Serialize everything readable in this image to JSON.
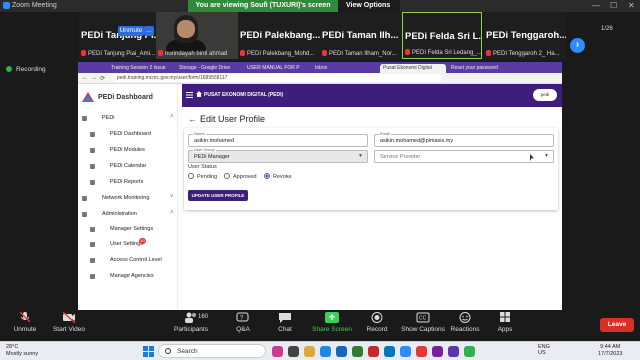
{
  "zoom_window": {
    "title": "Zoom Meeting",
    "viewing_banner": "You are viewing Soufi (TUXURI)'s screen",
    "view_options": "View Options",
    "window_controls": {
      "minimize": "—",
      "maximize": "☐",
      "close": "✕"
    }
  },
  "gallery": {
    "tiles": [
      {
        "big": "PEDi Tanjung Pi...",
        "caption": "PEDI Tanjung Piai_Ami..."
      },
      {
        "big": "",
        "caption": "nurindayah binti ahmad"
      },
      {
        "big": "PEDi Palekbang...",
        "caption": "PEDI Palekbang_Mohd..."
      },
      {
        "big": "PEDi Taman Ilh...",
        "caption": "PEDI Taman Ilham_Nor..."
      },
      {
        "big": "PEDi Felda Sri L...",
        "caption": "PEDI Felda Sri Ledang_..."
      },
      {
        "big": "PEDi Tenggaroh...",
        "caption": "PEDI Tenggaroh 2_ Ha..."
      }
    ],
    "unmute_label": "Unmute",
    "more_label": "...",
    "pager": "1/26",
    "next_label": "›"
  },
  "recording": {
    "label": "Recording"
  },
  "browser": {
    "tabs": [
      "Training Session 2 Issue",
      "Storage - Google Drive",
      "USER MANUAL FOR P",
      "Inbox",
      "Pusat Ekonomi Digital",
      "Reset your password"
    ],
    "url": "pedi.training.mcmc.gov.my/user/form/1689558117"
  },
  "app": {
    "brand": "PEDi Dashboard",
    "topbar_title": "PUSAT EKONOMI DIGITAL (PEDI)",
    "user_chip": "pedi",
    "sidebar": [
      {
        "label": "PEDi",
        "type": "top"
      },
      {
        "label": "PEDi Dashboard",
        "type": "sub"
      },
      {
        "label": "PEDi Modules",
        "type": "sub"
      },
      {
        "label": "PEDi Calendar",
        "type": "sub"
      },
      {
        "label": "PEDi Reports",
        "type": "sub"
      },
      {
        "label": "Network Monitoring",
        "type": "top"
      },
      {
        "label": "Administration",
        "type": "top"
      },
      {
        "label": "Manager Settings",
        "type": "sub"
      },
      {
        "label": "User Settings",
        "type": "sub"
      },
      {
        "label": "Access Control Level",
        "type": "sub"
      },
      {
        "label": "Manage Agencies",
        "type": "sub"
      }
    ],
    "user_settings_badge": "10",
    "page_title": "Edit User Profile",
    "form": {
      "name_label": "Name",
      "name_value": "asikin.mohamed",
      "email_label": "Email",
      "email_value": "asikin.mohamed@pimaxis.my",
      "group_label": "User Group",
      "group_value": "PEDi Manager",
      "provider_placeholder": "Service Provider",
      "status_label": "User Status",
      "status_options": [
        "Pending",
        "Approved",
        "Revoke"
      ],
      "status_selected": "Revoke",
      "submit_label": "UPDATE USER PROFILE"
    }
  },
  "toolbar": {
    "unmute": "Unmute",
    "start_video": "Start Video",
    "participants": "Participants",
    "participants_count": "160",
    "qa": "Q&A",
    "chat": "Chat",
    "share_screen": "Share Screen",
    "record": "Record",
    "show_captions": "Show Captions",
    "reactions": "Reactions",
    "apps": "Apps",
    "leave": "Leave"
  },
  "taskbar": {
    "temperature": "28°C",
    "weather": "Mostly sunny",
    "search_label": "Search",
    "lang": "ENG",
    "region": "US",
    "time": "9:44 AM",
    "date": "17/7/2023"
  },
  "colors": {
    "zoom_blue": "#2d8cff",
    "share_green": "#3ccf5a",
    "leave_red": "#d93025",
    "app_purple": "#3f1d7d"
  }
}
